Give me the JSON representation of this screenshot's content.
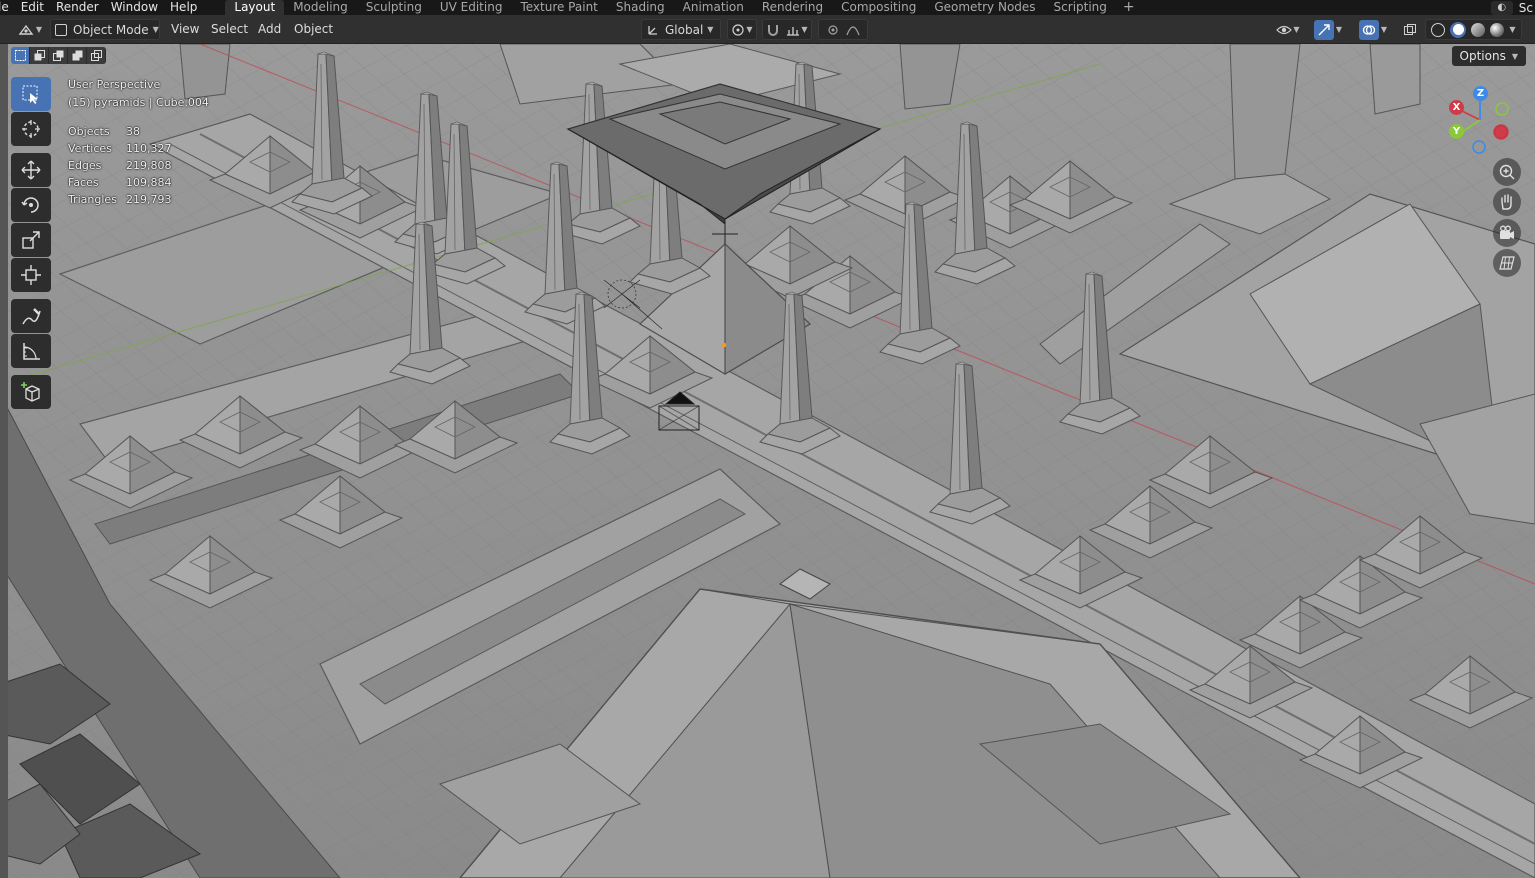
{
  "menu": {
    "items": [
      "le",
      "Edit",
      "Render",
      "Window",
      "Help"
    ]
  },
  "workspaces": {
    "tabs": [
      "Layout",
      "Modeling",
      "Sculpting",
      "UV Editing",
      "Texture Paint",
      "Shading",
      "Animation",
      "Rendering",
      "Compositing",
      "Geometry Nodes",
      "Scripting"
    ],
    "add_label": "+",
    "active": "Layout"
  },
  "scene": {
    "label": "Sc"
  },
  "header": {
    "mode": "Object Mode",
    "view": "View",
    "select": "Select",
    "add": "Add",
    "object": "Object",
    "orientation": "Global"
  },
  "viewport": {
    "perspective": "User Perspective",
    "collection_info": "(15) pyramids | Cube.004",
    "options_label": "Options",
    "stats": [
      {
        "label": "Objects",
        "value": "38"
      },
      {
        "label": "Vertices",
        "value": "110,327"
      },
      {
        "label": "Edges",
        "value": "219,808"
      },
      {
        "label": "Faces",
        "value": "109,884"
      },
      {
        "label": "Triangles",
        "value": "219,793"
      }
    ],
    "gizmo": {
      "x_label": "X",
      "y_label": "Y",
      "z_label": "Z"
    }
  },
  "colors": {
    "accent": "#4772b3",
    "axis_x": "#d13a48",
    "axis_y": "#8ac83a",
    "axis_z": "#3d8ae8",
    "viewport_bg": "#8e8e8e"
  },
  "icons": {
    "tools": [
      "select-box-icon",
      "cursor-icon",
      "move-icon",
      "rotate-icon",
      "scale-icon",
      "transform-icon",
      "annotate-icon",
      "measure-icon",
      "add-cube-icon"
    ],
    "nav": [
      "zoom-icon",
      "pan-hand-icon",
      "camera-icon",
      "ortho-grid-icon"
    ]
  }
}
